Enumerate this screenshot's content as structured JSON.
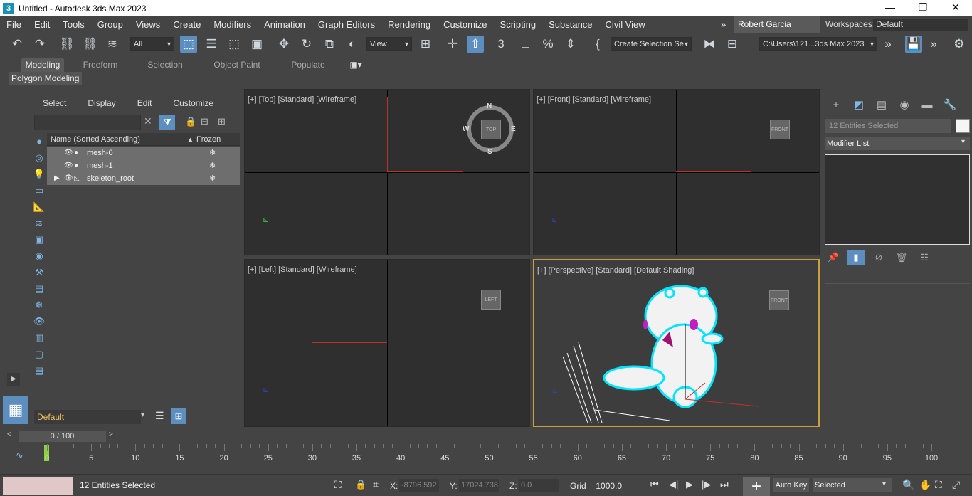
{
  "titlebar": {
    "title": "Untitled - Autodesk 3ds Max 2023",
    "app_icon": "3",
    "min": "—",
    "restore": "❐",
    "close": "✕"
  },
  "menu": {
    "items": [
      "File",
      "Edit",
      "Tools",
      "Group",
      "Views",
      "Create",
      "Modifiers",
      "Animation",
      "Graph Editors",
      "Rendering",
      "Customize",
      "Scripting",
      "Substance",
      "Civil View"
    ],
    "more": "»",
    "user": "Robert Garcia",
    "workspaces_label": "Workspaces:",
    "workspace": "Default"
  },
  "toolbar": {
    "filter": "All",
    "refcoord": "View",
    "selset": "Create Selection Se",
    "path": "C:\\Users\\121...3ds Max 2023"
  },
  "ribbon": {
    "tabs": [
      "Modeling",
      "Freeform",
      "Selection",
      "Object Paint",
      "Populate"
    ],
    "panel": "Polygon Modeling"
  },
  "scene_explorer": {
    "tabs": [
      "Select",
      "Display",
      "Edit",
      "Customize"
    ],
    "col_name": "Name (Sorted Ascending)",
    "sort_arrow": "▲",
    "col_frozen": "Frozen",
    "rows": [
      {
        "name": "mesh-0"
      },
      {
        "name": "mesh-1"
      },
      {
        "name": "skeleton_root"
      }
    ],
    "layer": "Default"
  },
  "viewports": {
    "top": {
      "label": "[+] [Top] [Standard] [Wireframe]",
      "cube": "TOP",
      "compass": {
        "n": "N",
        "s": "S",
        "e": "E",
        "w": "W"
      }
    },
    "front": {
      "label": "[+] [Front] [Standard] [Wireframe]",
      "cube": "FRONT"
    },
    "left": {
      "label": "[+] [Left] [Standard] [Wireframe]",
      "cube": "LEFT"
    },
    "persp": {
      "label": "[+] [Perspective] [Standard] [Default Shading]",
      "cube": "FRONT"
    }
  },
  "command_panel": {
    "name_field": "12 Entities Selected",
    "modifier_list": "Modifier List"
  },
  "timeline": {
    "frame": "0 / 100",
    "prev": "<",
    "next": ">",
    "ticks": [
      "0",
      "5",
      "10",
      "15",
      "20",
      "25",
      "30",
      "35",
      "40",
      "45",
      "50",
      "55",
      "60",
      "65",
      "70",
      "75",
      "80",
      "85",
      "90",
      "95",
      "100"
    ]
  },
  "status": {
    "selected": "12 Entities Selected",
    "x_label": "X:",
    "x": "-8796.592",
    "y_label": "Y:",
    "y": "17024.738",
    "z_label": "Z:",
    "z": "0.0",
    "grid": "Grid = 1000.0",
    "autokey": "Auto Key",
    "selected_dd": "Selected"
  },
  "colors": {
    "accent": "#5c8fbf",
    "viewport_active": "#c8a040",
    "selection_outline": "#00e5ff"
  }
}
